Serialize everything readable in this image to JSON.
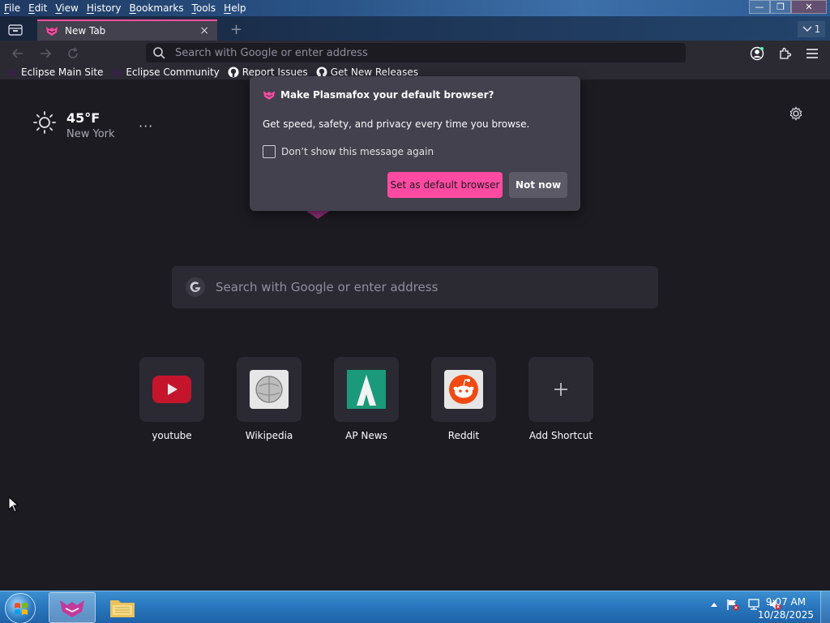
{
  "menu": {
    "items": [
      {
        "label": "File",
        "ul": "F",
        "rest": "ile"
      },
      {
        "label": "Edit",
        "ul": "E",
        "rest": "dit"
      },
      {
        "label": "View",
        "ul": "V",
        "rest": "iew"
      },
      {
        "label": "History",
        "ul": "H",
        "rest": "istory"
      },
      {
        "label": "Bookmarks",
        "ul": "B",
        "rest": "ookmarks"
      },
      {
        "label": "Tools",
        "ul": "T",
        "rest": "ools"
      },
      {
        "label": "Help",
        "ul": "H",
        "rest": "elp"
      }
    ]
  },
  "window_controls": {
    "minimize": "—",
    "maximize": "❐",
    "close": "✕"
  },
  "tabs": {
    "active_title": "New Tab",
    "close_glyph": "×",
    "new_tab_glyph": "+",
    "overflow_count": "1"
  },
  "urlbar": {
    "placeholder": "Search with Google or enter address"
  },
  "bookmarks": [
    {
      "label": "Eclipse Main Site",
      "icon": "eclipse-icon"
    },
    {
      "label": "Eclipse Community",
      "icon": "eclipse-icon"
    },
    {
      "label": "Report Issues",
      "icon": "github-icon"
    },
    {
      "label": "Get New Releases",
      "icon": "github-icon"
    }
  ],
  "weather": {
    "temperature": "45°F",
    "city": "New York",
    "more": "···"
  },
  "search": {
    "placeholder": "Search with Google or enter address"
  },
  "shortcuts": [
    {
      "label": "youtube",
      "icon": "youtube-icon"
    },
    {
      "label": "Wikipedia",
      "icon": "wikipedia-icon"
    },
    {
      "label": "AP News",
      "icon": "apnews-icon"
    },
    {
      "label": "Reddit",
      "icon": "reddit-icon"
    },
    {
      "label": "Add Shortcut",
      "icon": "plus-icon"
    }
  ],
  "dialog": {
    "title": "Make Plasmafox your default browser?",
    "body": "Get speed, safety, and privacy every time you browse.",
    "checkbox_label": "Don’t show this message again",
    "checked": false,
    "primary_label": "Set as default browser",
    "secondary_label": "Not now"
  },
  "taskbar": {
    "time": "9:07 AM",
    "date": "10/28/2025"
  },
  "colors": {
    "accent_pink": "#ff4aa2",
    "background": "#1c1b22",
    "panel": "#42414d"
  }
}
